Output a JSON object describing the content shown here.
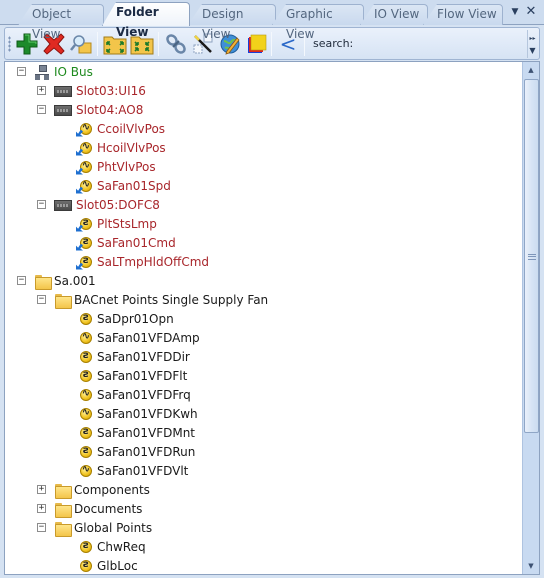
{
  "tabs": [
    {
      "label": "Object View",
      "active": false
    },
    {
      "label": "Folder View",
      "active": true
    },
    {
      "label": "Design View",
      "active": false
    },
    {
      "label": "Graphic View",
      "active": false
    },
    {
      "label": "IO View",
      "active": false
    },
    {
      "label": "Flow View",
      "active": false
    }
  ],
  "tab_controls": {
    "menu_glyph": "▼",
    "close_glyph": "✕"
  },
  "toolbar": {
    "buttons": [
      {
        "name": "add-button",
        "icon": "plus-icon"
      },
      {
        "name": "delete-button",
        "icon": "x-icon"
      },
      {
        "name": "find-button",
        "icon": "magnifier-folder-icon"
      },
      {
        "name": "expand-all-button",
        "icon": "folder-expand-icon"
      },
      {
        "name": "collapse-all-button",
        "icon": "folder-collapse-icon"
      },
      {
        "name": "link-button",
        "icon": "chain-link-icon"
      },
      {
        "name": "wand-button",
        "icon": "magic-wand-icon"
      },
      {
        "name": "edit-globe-button",
        "icon": "globe-pencil-icon"
      },
      {
        "name": "note-button",
        "icon": "sticky-note-icon"
      },
      {
        "name": "back-button",
        "icon": "chevron-left-icon"
      }
    ],
    "back_glyph": "<",
    "search_label": "search:",
    "search_value": "",
    "overflow_glyph": "▸▸"
  },
  "tree": [
    {
      "label": "IO Bus",
      "level": 0,
      "expander": "minus",
      "icon": "network",
      "color": "green"
    },
    {
      "label": "Slot03:UI16",
      "level": 1,
      "expander": "plus",
      "icon": "slot",
      "color": "red"
    },
    {
      "label": "Slot04:AO8",
      "level": 1,
      "expander": "minus",
      "icon": "slot",
      "color": "red"
    },
    {
      "label": "CcoilVlvPos",
      "level": 2,
      "expander": "",
      "icon": "analog-io",
      "color": "red"
    },
    {
      "label": "HcoilVlvPos",
      "level": 2,
      "expander": "",
      "icon": "analog-io",
      "color": "red"
    },
    {
      "label": "PhtVlvPos",
      "level": 2,
      "expander": "",
      "icon": "analog-io",
      "color": "red"
    },
    {
      "label": "SaFan01Spd",
      "level": 2,
      "expander": "",
      "icon": "analog-io",
      "color": "red"
    },
    {
      "label": "Slot05:DOFC8",
      "level": 1,
      "expander": "minus",
      "icon": "slot",
      "color": "red"
    },
    {
      "label": "PltStsLmp",
      "level": 2,
      "expander": "",
      "icon": "binary-io",
      "color": "red"
    },
    {
      "label": "SaFan01Cmd",
      "level": 2,
      "expander": "",
      "icon": "binary-io",
      "color": "red"
    },
    {
      "label": "SaLTmpHldOffCmd",
      "level": 2,
      "expander": "",
      "icon": "binary-io",
      "color": "red"
    },
    {
      "label": "Sa.001",
      "level": 0,
      "expander": "minus",
      "icon": "folder",
      "color": "black"
    },
    {
      "label": "BACnet Points Single Supply Fan",
      "level": 1,
      "expander": "minus",
      "icon": "folder",
      "color": "black"
    },
    {
      "label": "SaDpr01Opn",
      "level": 2,
      "expander": "",
      "icon": "binary",
      "color": "black"
    },
    {
      "label": "SaFan01VFDAmp",
      "level": 2,
      "expander": "",
      "icon": "analog",
      "color": "black"
    },
    {
      "label": "SaFan01VFDDir",
      "level": 2,
      "expander": "",
      "icon": "binary",
      "color": "black"
    },
    {
      "label": "SaFan01VFDFlt",
      "level": 2,
      "expander": "",
      "icon": "binary",
      "color": "black"
    },
    {
      "label": "SaFan01VFDFrq",
      "level": 2,
      "expander": "",
      "icon": "analog",
      "color": "black"
    },
    {
      "label": "SaFan01VFDKwh",
      "level": 2,
      "expander": "",
      "icon": "analog",
      "color": "black"
    },
    {
      "label": "SaFan01VFDMnt",
      "level": 2,
      "expander": "",
      "icon": "binary",
      "color": "black"
    },
    {
      "label": "SaFan01VFDRun",
      "level": 2,
      "expander": "",
      "icon": "binary",
      "color": "black"
    },
    {
      "label": "SaFan01VFDVlt",
      "level": 2,
      "expander": "",
      "icon": "analog",
      "color": "black"
    },
    {
      "label": "Components",
      "level": 1,
      "expander": "plus",
      "icon": "folder",
      "color": "black"
    },
    {
      "label": "Documents",
      "level": 1,
      "expander": "plus",
      "icon": "folder",
      "color": "black"
    },
    {
      "label": "Global Points",
      "level": 1,
      "expander": "minus",
      "icon": "folder",
      "color": "black"
    },
    {
      "label": "ChwReq",
      "level": 2,
      "expander": "",
      "icon": "binary",
      "color": "black"
    },
    {
      "label": "GlbLoc",
      "level": 2,
      "expander": "",
      "icon": "binary",
      "color": "black"
    }
  ],
  "glyphs": {
    "plus": "+",
    "minus": "−",
    "analog": "∿",
    "binary": "ƨ",
    "scroll_up": "▲",
    "scroll_down": "▼"
  },
  "colors": {
    "green": "#1e8a1e",
    "red": "#a8262b",
    "black": "#1a1a1a"
  }
}
